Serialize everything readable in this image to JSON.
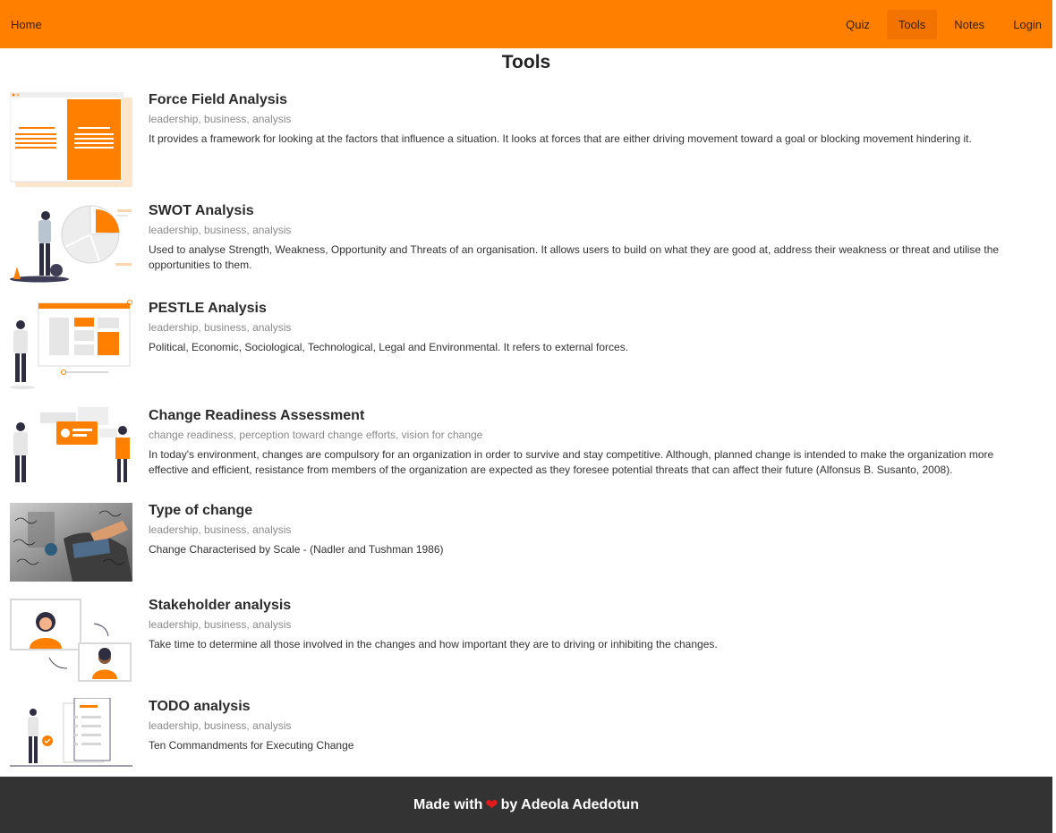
{
  "nav": {
    "home": "Home",
    "links": [
      "Quiz",
      "Tools",
      "Notes",
      "Login"
    ],
    "active": "Tools"
  },
  "page_title": "Tools",
  "colors": {
    "accent": "#ff7f00",
    "footer": "#333333",
    "heart": "#e41b1b"
  },
  "tools": [
    {
      "title": "Force Field Analysis",
      "tags": "leadership, business, analysis",
      "desc": "It provides a framework for looking at the factors that influence a situation. It looks at forces that are either driving movement toward a goal or blocking movement hindering it."
    },
    {
      "title": "SWOT Analysis",
      "tags": "leadership, business, analysis",
      "desc": "Used to analyse Strength, Weakness, Opportunity and Threats of an organisation. It allows users to build on what they are good at, address their weakness or threat and utilise the opportunities to them."
    },
    {
      "title": "PESTLE Analysis",
      "tags": "leadership, business, analysis",
      "desc": "Political, Economic, Sociological, Technological, Legal and Environmental. It refers to external forces."
    },
    {
      "title": "Change Readiness Assessment",
      "tags": "change readiness, perception toward change efforts, vision for change",
      "desc": "In today's environment, changes are compulsory for an organization in order to survive and stay competitive. Although, planned change is intended to make the organization more effective and efficient, resistance from members of the organization are expected as they foresee potential threats that can affect their future (Alfonsus B. Susanto, 2008)."
    },
    {
      "title": "Type of change",
      "tags": "leadership, business, analysis",
      "desc": "Change Characterised by Scale - (Nadler and Tushman 1986)"
    },
    {
      "title": "Stakeholder analysis",
      "tags": "leadership, business, analysis",
      "desc": "Take time to determine all those involved in the changes and how important they are to driving or inhibiting the changes."
    },
    {
      "title": "TODO analysis",
      "tags": "leadership, business, analysis",
      "desc": "Ten Commandments for Executing Change"
    }
  ],
  "footer": {
    "prefix": "Made with",
    "suffix": "by Adeola Adedotun",
    "icon": "heart-icon"
  }
}
